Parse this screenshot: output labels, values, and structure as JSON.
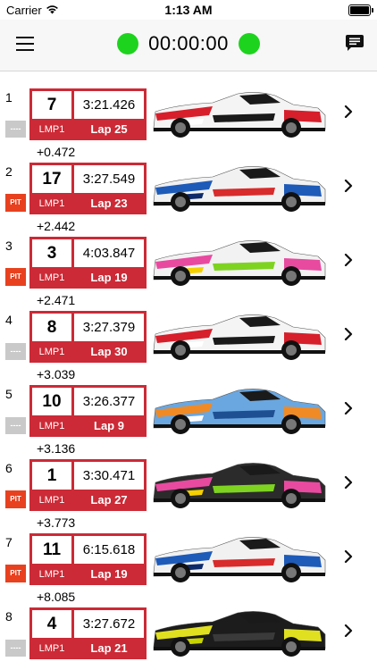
{
  "status_bar": {
    "carrier": "Carrier",
    "time": "1:13 AM"
  },
  "header": {
    "timer": "00:00:00",
    "timer_color": "#1ed31e"
  },
  "colors": {
    "card": "#cc2a36",
    "pit": "#e8411f",
    "no_pit": "#c9c9c9"
  },
  "rows": [
    {
      "position": "1",
      "pit": "----",
      "car_number": "7",
      "lap_time": "3:21.426",
      "class": "LMP1",
      "lap": "Lap 25",
      "gap": "+0.472",
      "livery": "toyota-white-red"
    },
    {
      "position": "2",
      "pit": "PIT",
      "car_number": "17",
      "lap_time": "3:27.549",
      "class": "LMP1",
      "lap": "Lap 23",
      "gap": "+2.442",
      "livery": "smp-blue-white-red"
    },
    {
      "position": "3",
      "pit": "PIT",
      "car_number": "3",
      "lap_time": "4:03.847",
      "class": "LMP1",
      "lap": "Lap 19",
      "gap": "+2.471",
      "livery": "rebellion-art"
    },
    {
      "position": "4",
      "pit": "----",
      "car_number": "8",
      "lap_time": "3:27.379",
      "class": "LMP1",
      "lap": "Lap 30",
      "gap": "+3.039",
      "livery": "toyota-white-red"
    },
    {
      "position": "5",
      "pit": "----",
      "car_number": "10",
      "lap_time": "3:26.377",
      "class": "LMP1",
      "lap": "Lap 9",
      "gap": "+3.136",
      "livery": "gulf-blue-orange"
    },
    {
      "position": "6",
      "pit": "PIT",
      "car_number": "1",
      "lap_time": "3:30.471",
      "class": "LMP1",
      "lap": "Lap 27",
      "gap": "+3.773",
      "livery": "rebellion-dark-art"
    },
    {
      "position": "7",
      "pit": "PIT",
      "car_number": "11",
      "lap_time": "6:15.618",
      "class": "LMP1",
      "lap": "Lap 19",
      "gap": "+8.085",
      "livery": "smp-blue-white-red"
    },
    {
      "position": "8",
      "pit": "----",
      "car_number": "4",
      "lap_time": "3:27.672",
      "class": "LMP1",
      "lap": "Lap 21",
      "gap": "",
      "livery": "bykolles-yellow-black"
    }
  ]
}
